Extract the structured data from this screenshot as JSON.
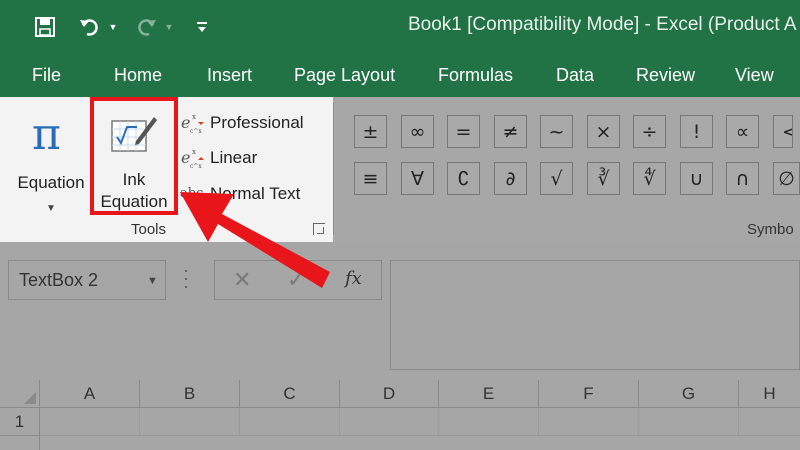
{
  "window": {
    "title": "Book1  [Compatibility Mode]  -  Excel (Product A"
  },
  "qat": {
    "save_icon": "save-icon",
    "undo_icon": "undo-icon",
    "redo_icon": "redo-icon",
    "customize_icon": "customize-qat-icon"
  },
  "tabs": [
    "File",
    "Home",
    "Insert",
    "Page Layout",
    "Formulas",
    "Data",
    "Review",
    "View"
  ],
  "ribbon": {
    "equation_label": "Equation",
    "ink_label_1": "Ink",
    "ink_label_2": "Equation",
    "formats": [
      {
        "label": "Professional",
        "icon": "professional-format-icon"
      },
      {
        "label": "Linear",
        "icon": "linear-format-icon"
      },
      {
        "label": "Normal Text",
        "icon": "normal-text-icon",
        "icon_text": "abc"
      }
    ],
    "tools_group_label": "Tools",
    "symbols_group_label": "Symbo",
    "symbols_row1": [
      "±",
      "∞",
      "=",
      "≠",
      "~",
      "×",
      "÷",
      "!",
      "∝",
      "<"
    ],
    "symbols_row2": [
      "≡",
      "∀",
      "∁",
      "∂",
      "√",
      "∛",
      "∜",
      "∪",
      "∩",
      "∅"
    ]
  },
  "formula_bar": {
    "name_box_value": "TextBox 2",
    "cancel_glyph": "✕",
    "enter_glyph": "✓",
    "fx_label": "fx"
  },
  "grid": {
    "columns": [
      "A",
      "B",
      "C",
      "D",
      "E",
      "F",
      "G",
      "H"
    ],
    "rows": [
      "1"
    ]
  },
  "annotation": {
    "highlight_color": "#e8151b"
  }
}
